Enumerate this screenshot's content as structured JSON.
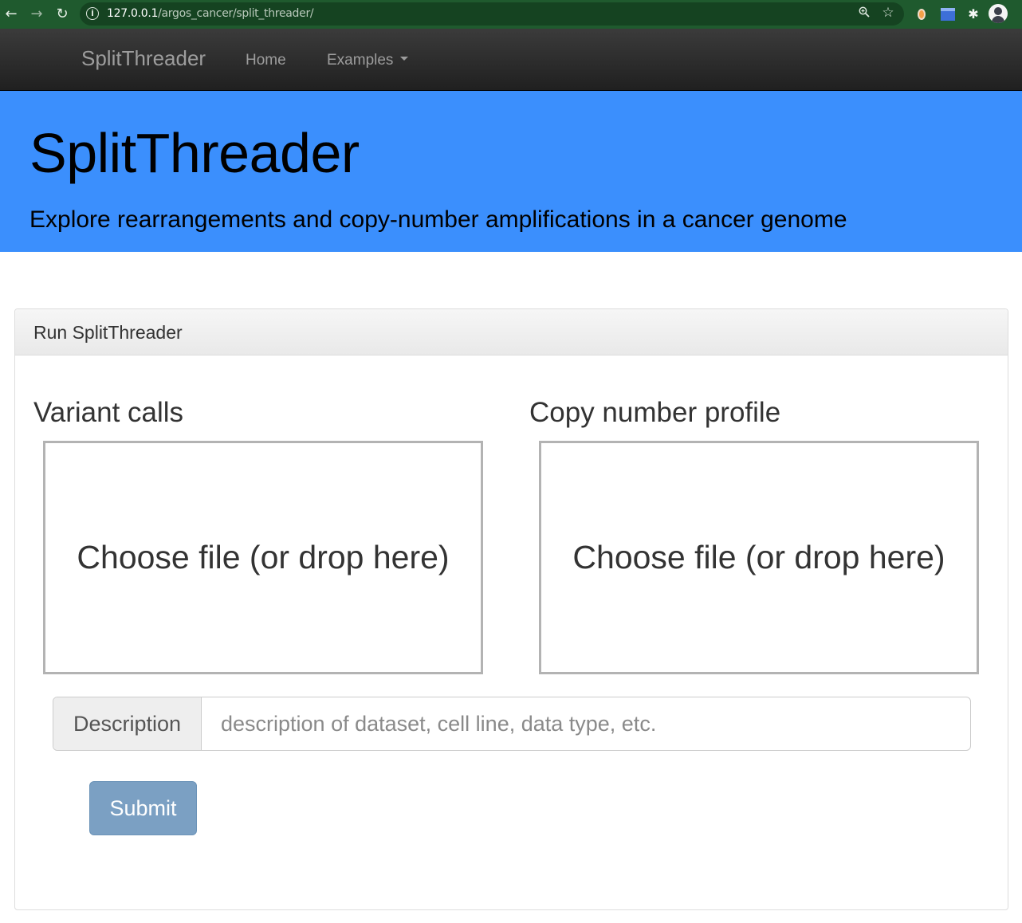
{
  "browser": {
    "url_host": "127.0.0.1",
    "url_path": "/argos_cancer/split_threader/"
  },
  "navbar": {
    "brand": "SplitThreader",
    "home": "Home",
    "examples": "Examples"
  },
  "jumbotron": {
    "title": "SplitThreader",
    "subtitle": "Explore rearrangements and copy-number amplifications in a cancer genome"
  },
  "panel": {
    "heading": "Run SplitThreader",
    "variant_calls": {
      "title": "Variant calls",
      "dropzone_label": "Choose file (or drop here)"
    },
    "copy_number": {
      "title": "Copy number profile",
      "dropzone_label": "Choose file (or drop here)"
    },
    "description": {
      "label": "Description",
      "value": "",
      "placeholder": "description of dataset, cell line, data type, etc."
    },
    "submit_label": "Submit"
  },
  "colors": {
    "jumbotron_bg": "#3b8ffd",
    "navbar_bg": "#222222",
    "submit_bg": "#7ba0c3",
    "browser_chrome": "#1f5a2e"
  },
  "icons": [
    "back-arrow-icon",
    "forward-arrow-icon",
    "reload-icon",
    "info-icon",
    "zoom-icon",
    "star-icon",
    "extension-icon",
    "puzzle-icon",
    "profile-avatar-icon",
    "caret-down-icon"
  ]
}
